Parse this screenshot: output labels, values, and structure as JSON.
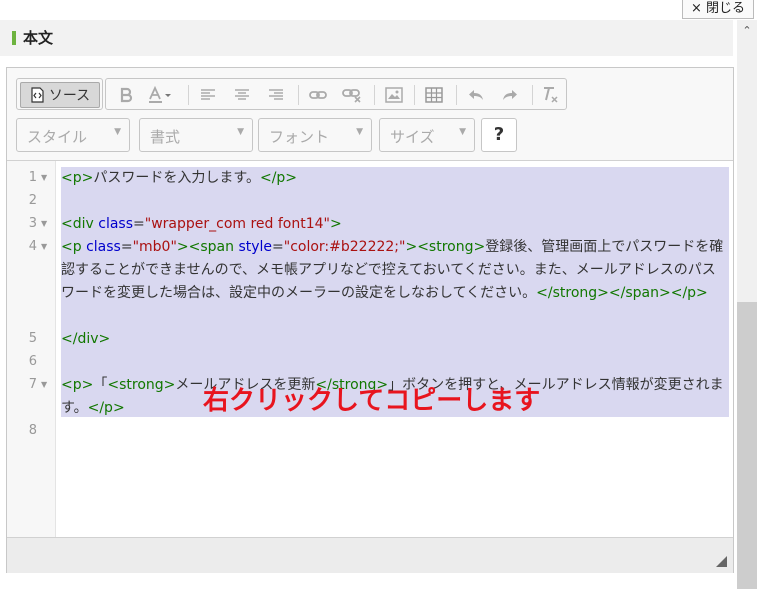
{
  "dialog": {
    "close_label": "× 閉じる"
  },
  "header": {
    "title": "本文"
  },
  "toolbar": {
    "source_label": "ソース",
    "icons": [
      "bold-icon",
      "font-color-icon",
      "align-left-icon",
      "align-center-icon",
      "align-right-icon",
      "link-icon",
      "unlink-icon",
      "image-icon",
      "table-icon",
      "undo-icon",
      "redo-icon",
      "remove-format-icon"
    ],
    "style_label": "スタイル",
    "format_label": "書式",
    "font_label": "フォント",
    "size_label": "サイズ",
    "help_label": "?"
  },
  "code": {
    "line_numbers": [
      "1",
      "2",
      "3",
      "4",
      "5",
      "6",
      "7",
      "8"
    ],
    "line1": {
      "open": "<p>",
      "text": "パスワードを入力します。",
      "close": "</p>"
    },
    "line3": {
      "open": "<div ",
      "attr": "class",
      "eq": "=",
      "val": "\"wrapper_com red font14\"",
      "end": ">"
    },
    "line4": {
      "p_open": "<p ",
      "p_attr": "class",
      "p_eq": "=",
      "p_val": "\"mb0\"",
      "p_end": ">",
      "span_open": "<span ",
      "span_attr": "style",
      "span_eq": "=",
      "span_val": "\"color:#b22222;\"",
      "span_end": ">",
      "strong_open": "<strong>",
      "text": "登録後、管理画面上でパスワードを確認することができませんので、メモ帳アプリなどで控えておいてください。また、メールアドレスのパスワードを変更した場合は、設定中のメーラーの設定をしなおしてください。",
      "strong_close": "</strong>",
      "span_close": "</span>",
      "p_close": "</p>"
    },
    "line5": {
      "close": "</div>"
    },
    "line7": {
      "p_open": "<p>",
      "t1": "「",
      "strong_open": "<strong>",
      "t2": "メールアドレスを更新",
      "strong_close": "</strong>",
      "t3": "」ボタンを押すと、メールアドレス情報が変更されます。",
      "p_close": "</p>"
    }
  },
  "annotation": {
    "text": "右クリックしてコピーします",
    "color": "#e8141e"
  }
}
